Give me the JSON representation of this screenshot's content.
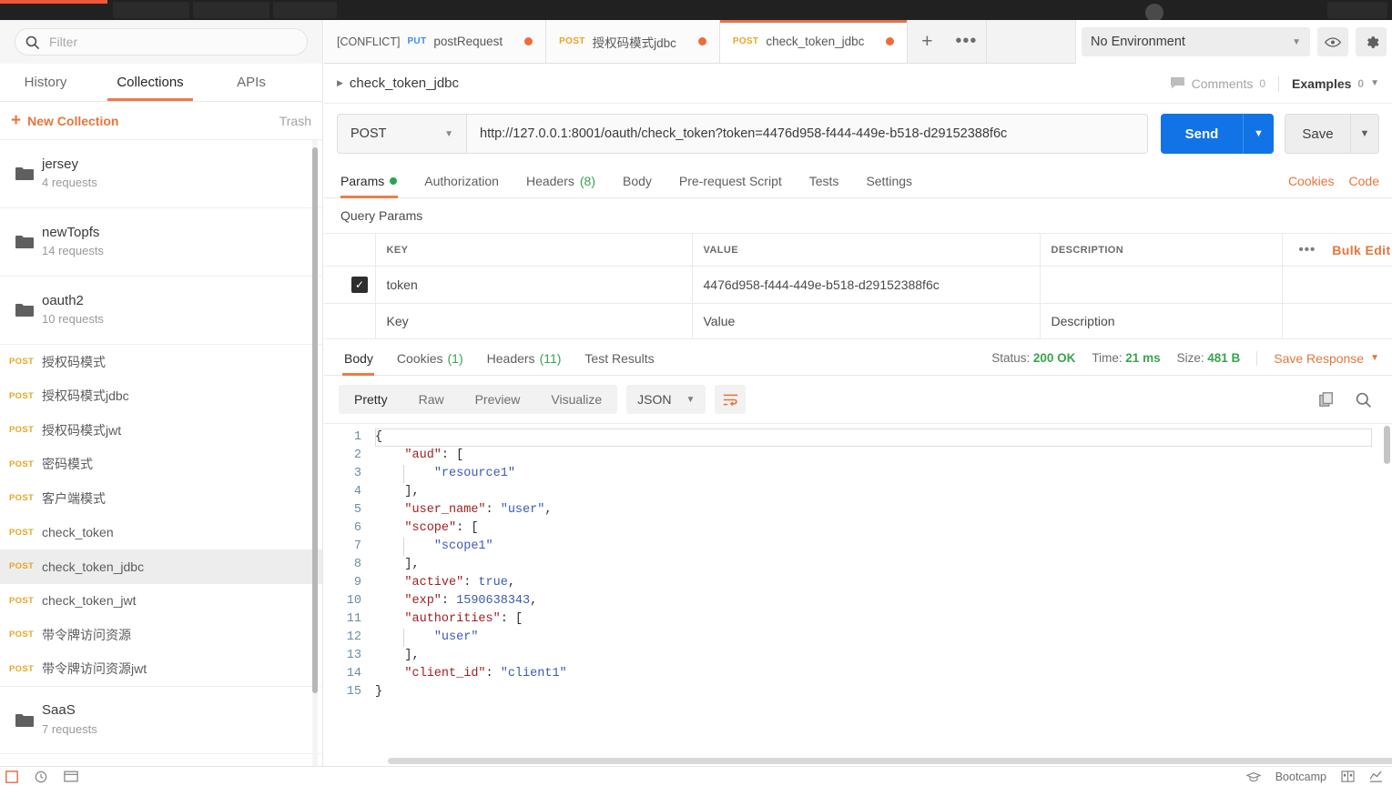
{
  "colors": {
    "accent_orange": "#ef7b45",
    "postman_orange": "#f26b37",
    "send_blue": "#1173e6",
    "method_post": "#e6a626",
    "method_put": "#3c8ee0",
    "status_green": "#3aa34e",
    "dark_bar": "#212121"
  },
  "sidebar": {
    "filter": {
      "placeholder": "Filter",
      "value": "",
      "icon": "search-icon"
    },
    "tabs": [
      {
        "label": "History",
        "active": false
      },
      {
        "label": "Collections",
        "active": true
      },
      {
        "label": "APIs",
        "active": false
      }
    ],
    "new_collection_label": "New Collection",
    "trash_label": "Trash",
    "folders": [
      {
        "name": "jersey",
        "count": "4 requests"
      },
      {
        "name": "newTopfs",
        "count": "14 requests"
      },
      {
        "name": "oauth2",
        "count": "10 requests"
      }
    ],
    "requests": [
      {
        "method": "POST",
        "name": "授权码模式",
        "selected": false
      },
      {
        "method": "POST",
        "name": "授权码模式jdbc",
        "selected": false
      },
      {
        "method": "POST",
        "name": "授权码模式jwt",
        "selected": false
      },
      {
        "method": "POST",
        "name": "密码模式",
        "selected": false
      },
      {
        "method": "POST",
        "name": "客户端模式",
        "selected": false
      },
      {
        "method": "POST",
        "name": "check_token",
        "selected": false
      },
      {
        "method": "POST",
        "name": "check_token_jdbc",
        "selected": true
      },
      {
        "method": "POST",
        "name": "check_token_jwt",
        "selected": false
      },
      {
        "method": "POST",
        "name": "带令牌访问资源",
        "selected": false
      },
      {
        "method": "POST",
        "name": "带令牌访问资源jwt",
        "selected": false
      }
    ],
    "folder_bottom": {
      "name": "SaaS",
      "count": "7 requests"
    }
  },
  "tabstrip": {
    "tabs": [
      {
        "conflict": "[CONFLICT]",
        "method": "PUT",
        "label": "postRequest",
        "unsaved": true,
        "active": false
      },
      {
        "conflict": "",
        "method": "POST",
        "label": "授权码模式jdbc",
        "unsaved": true,
        "active": false
      },
      {
        "conflict": "",
        "method": "POST",
        "label": "check_token_jdbc",
        "unsaved": true,
        "active": true
      }
    ],
    "add_label": "+",
    "more_label": "•••"
  },
  "environment": {
    "selected": "No Environment",
    "eye_icon": "eye-icon",
    "settings_icon": "gear-icon"
  },
  "request_header": {
    "breadcrumb": "check_token_jdbc",
    "comments_label": "Comments",
    "comments_count": "0",
    "examples_label": "Examples",
    "examples_count": "0"
  },
  "url_bar": {
    "method": "POST",
    "url": "http://127.0.0.1:8001/oauth/check_token?token=4476d958-f444-449e-b518-d29152388f6c",
    "send_label": "Send",
    "save_label": "Save"
  },
  "request_tabs": {
    "tabs": [
      {
        "label": "Params",
        "dot": true,
        "count": "",
        "active": true
      },
      {
        "label": "Authorization",
        "dot": false,
        "count": "",
        "active": false
      },
      {
        "label": "Headers",
        "dot": false,
        "count": "(8)",
        "active": false
      },
      {
        "label": "Body",
        "dot": false,
        "count": "",
        "active": false
      },
      {
        "label": "Pre-request Script",
        "dot": false,
        "count": "",
        "active": false
      },
      {
        "label": "Tests",
        "dot": false,
        "count": "",
        "active": false
      },
      {
        "label": "Settings",
        "dot": false,
        "count": "",
        "active": false
      }
    ],
    "cookies_link": "Cookies",
    "code_link": "Code"
  },
  "params": {
    "section_title": "Query Params",
    "headers": [
      "KEY",
      "VALUE",
      "DESCRIPTION"
    ],
    "bulk_edit_label": "Bulk Edit",
    "more_label": "•••",
    "rows": [
      {
        "checked": true,
        "key": "token",
        "value": "4476d958-f444-449e-b518-d29152388f6c",
        "description": ""
      }
    ],
    "placeholder_row": {
      "key": "Key",
      "value": "Value",
      "description": "Description"
    }
  },
  "response": {
    "tabs": [
      {
        "label": "Body",
        "count": "",
        "active": true
      },
      {
        "label": "Cookies",
        "count": "(1)",
        "active": false
      },
      {
        "label": "Headers",
        "count": "(11)",
        "active": false
      },
      {
        "label": "Test Results",
        "count": "",
        "active": false
      }
    ],
    "status_label": "Status:",
    "status_value": "200 OK",
    "time_label": "Time:",
    "time_value": "21 ms",
    "size_label": "Size:",
    "size_value": "481 B",
    "save_response_label": "Save Response",
    "view_modes": [
      {
        "label": "Pretty",
        "active": true
      },
      {
        "label": "Raw",
        "active": false
      },
      {
        "label": "Preview",
        "active": false
      },
      {
        "label": "Visualize",
        "active": false
      }
    ],
    "format": "JSON",
    "wrap_icon": "word-wrap-icon",
    "copy_icon": "copy-icon",
    "search_icon": "search-icon",
    "body_lines": [
      {
        "n": "1",
        "tokens": [
          {
            "t": "{",
            "c": "jpunct"
          }
        ]
      },
      {
        "n": "2",
        "indent": 1,
        "tokens": [
          {
            "t": "\"aud\"",
            "c": "jkey"
          },
          {
            "t": ": ",
            "c": "jpunct"
          },
          {
            "t": "[",
            "c": "jpunct"
          }
        ]
      },
      {
        "n": "3",
        "indent": 2,
        "tokens": [
          {
            "t": "\"resource1\"",
            "c": "jstr"
          }
        ]
      },
      {
        "n": "4",
        "indent": 1,
        "tokens": [
          {
            "t": "],",
            "c": "jpunct"
          }
        ]
      },
      {
        "n": "5",
        "indent": 1,
        "tokens": [
          {
            "t": "\"user_name\"",
            "c": "jkey"
          },
          {
            "t": ": ",
            "c": "jpunct"
          },
          {
            "t": "\"user\"",
            "c": "jstr"
          },
          {
            "t": ",",
            "c": "jpunct"
          }
        ]
      },
      {
        "n": "6",
        "indent": 1,
        "tokens": [
          {
            "t": "\"scope\"",
            "c": "jkey"
          },
          {
            "t": ": ",
            "c": "jpunct"
          },
          {
            "t": "[",
            "c": "jpunct"
          }
        ]
      },
      {
        "n": "7",
        "indent": 2,
        "tokens": [
          {
            "t": "\"scope1\"",
            "c": "jstr"
          }
        ]
      },
      {
        "n": "8",
        "indent": 1,
        "tokens": [
          {
            "t": "],",
            "c": "jpunct"
          }
        ]
      },
      {
        "n": "9",
        "indent": 1,
        "tokens": [
          {
            "t": "\"active\"",
            "c": "jkey"
          },
          {
            "t": ": ",
            "c": "jpunct"
          },
          {
            "t": "true",
            "c": "jbool"
          },
          {
            "t": ",",
            "c": "jpunct"
          }
        ]
      },
      {
        "n": "10",
        "indent": 1,
        "tokens": [
          {
            "t": "\"exp\"",
            "c": "jkey"
          },
          {
            "t": ": ",
            "c": "jpunct"
          },
          {
            "t": "1590638343",
            "c": "jnum"
          },
          {
            "t": ",",
            "c": "jpunct"
          }
        ]
      },
      {
        "n": "11",
        "indent": 1,
        "tokens": [
          {
            "t": "\"authorities\"",
            "c": "jkey"
          },
          {
            "t": ": ",
            "c": "jpunct"
          },
          {
            "t": "[",
            "c": "jpunct"
          }
        ]
      },
      {
        "n": "12",
        "indent": 2,
        "tokens": [
          {
            "t": "\"user\"",
            "c": "jstr"
          }
        ]
      },
      {
        "n": "13",
        "indent": 1,
        "tokens": [
          {
            "t": "],",
            "c": "jpunct"
          }
        ]
      },
      {
        "n": "14",
        "indent": 1,
        "tokens": [
          {
            "t": "\"client_id\"",
            "c": "jkey"
          },
          {
            "t": ": ",
            "c": "jpunct"
          },
          {
            "t": "\"client1\"",
            "c": "jstr"
          }
        ]
      },
      {
        "n": "15",
        "tokens": [
          {
            "t": "}",
            "c": "jpunct"
          }
        ]
      }
    ]
  },
  "statusbar": {
    "bootcamp_label": "Bootcamp",
    "icons": [
      "sidebar-toggle-icon",
      "history-icon",
      "console-icon",
      "graduation-cap-icon",
      "layout-icon",
      "trend-icon"
    ]
  }
}
